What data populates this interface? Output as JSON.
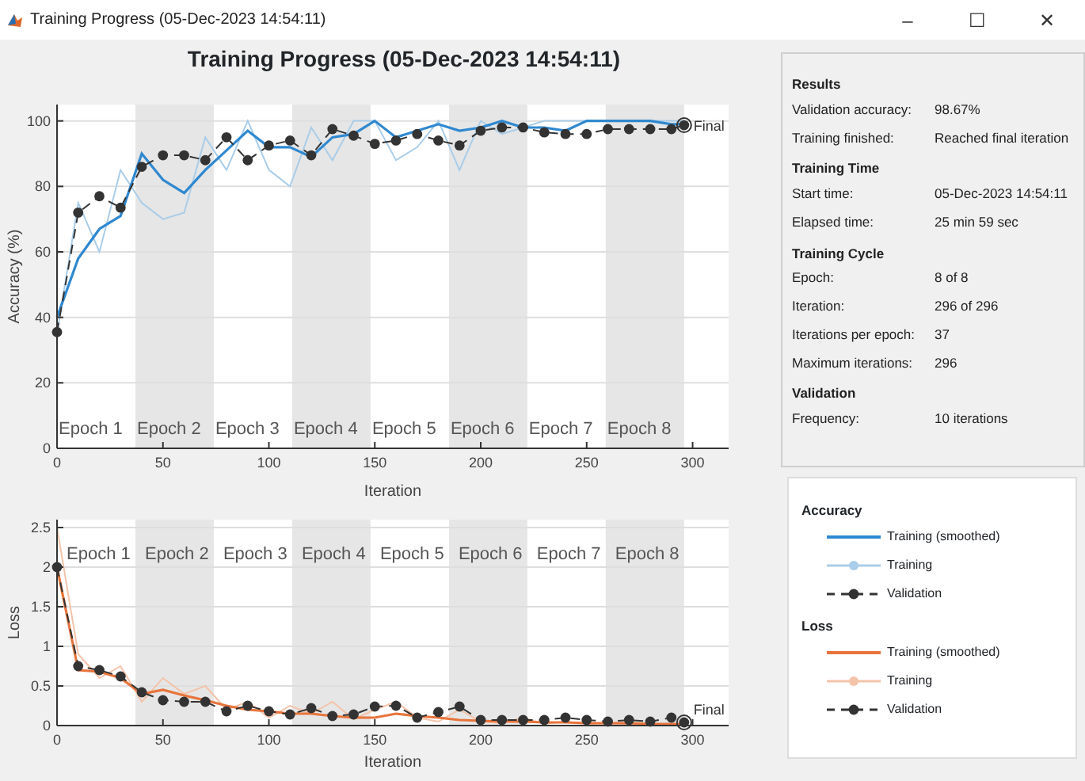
{
  "window": {
    "title": "Training Progress (05-Dec-2023 14:54:11)",
    "controls": [
      "–",
      "☐",
      "✕"
    ]
  },
  "heading": "Training Progress (05-Dec-2023 14:54:11)",
  "accuracy_plot": {
    "chart_data": {
      "type": "line",
      "xlabel": "Iteration",
      "ylabel": "Accuracy (%)",
      "grid": true,
      "x": [
        0,
        10,
        20,
        30,
        40,
        50,
        60,
        70,
        80,
        90,
        100,
        110,
        120,
        130,
        140,
        150,
        160,
        170,
        180,
        190,
        200,
        210,
        220,
        230,
        240,
        250,
        260,
        270,
        280,
        290,
        296
      ],
      "xlim": [
        0,
        317
      ],
      "ylim": [
        0,
        105
      ],
      "xticks": [
        0,
        50,
        100,
        150,
        200,
        250,
        300
      ],
      "yticks": [
        0,
        20,
        40,
        60,
        80,
        100
      ],
      "series": [
        {
          "name": "Training (smoothed)",
          "color": "#2f88d0",
          "line_style": "solid",
          "values": [
            40,
            58,
            67,
            71,
            90,
            82,
            78,
            85,
            91,
            97,
            92,
            92,
            89,
            95,
            96,
            100,
            95,
            97,
            99,
            97,
            98,
            100,
            98,
            98,
            97,
            100,
            100,
            100,
            100,
            99,
            99
          ]
        },
        {
          "name": "Training",
          "color": "#a9cde9",
          "line_style": "solid",
          "values": [
            35,
            75,
            60,
            85,
            75,
            70,
            72,
            95,
            85,
            100,
            85,
            80,
            98,
            88,
            100,
            100,
            88,
            92,
            100,
            85,
            100,
            96,
            98,
            100,
            100,
            100,
            100,
            100,
            100,
            100,
            100
          ]
        },
        {
          "name": "Validation",
          "color": "#333333",
          "line_style": "dashed",
          "marker": "circle",
          "values": [
            35.5,
            72,
            77,
            73.5,
            86,
            89.5,
            89.5,
            88,
            95,
            88,
            92.5,
            94,
            89.5,
            97.5,
            95.5,
            93,
            94,
            96,
            94,
            92.5,
            97,
            98,
            98,
            96.5,
            96,
            96,
            97.5,
            97.5,
            97.5,
            97.5,
            98.7
          ]
        }
      ],
      "annotations": [
        "Epoch 1",
        "Epoch 2",
        "Epoch 3",
        "Epoch 4",
        "Epoch 5",
        "Epoch 6",
        "Epoch 7",
        "Epoch 8",
        "Final"
      ]
    }
  },
  "loss_plot": {
    "chart_data": {
      "type": "line",
      "xlabel": "Iteration",
      "ylabel": "Loss",
      "grid": true,
      "x": [
        0,
        10,
        20,
        30,
        40,
        50,
        60,
        70,
        80,
        90,
        100,
        110,
        120,
        130,
        140,
        150,
        160,
        170,
        180,
        190,
        200,
        210,
        220,
        230,
        240,
        250,
        260,
        270,
        280,
        290,
        296
      ],
      "xlim": [
        0,
        317
      ],
      "ylim": [
        0,
        2.6
      ],
      "xticks": [
        0,
        50,
        100,
        150,
        200,
        250,
        300
      ],
      "yticks": [
        0,
        0.5,
        1,
        1.5,
        2,
        2.5
      ],
      "series": [
        {
          "name": "Training (smoothed)",
          "color": "#e8743b",
          "line_style": "solid",
          "values": [
            2.0,
            0.7,
            0.68,
            0.6,
            0.4,
            0.45,
            0.38,
            0.32,
            0.25,
            0.2,
            0.18,
            0.15,
            0.15,
            0.12,
            0.1,
            0.1,
            0.15,
            0.12,
            0.1,
            0.07,
            0.06,
            0.05,
            0.05,
            0.04,
            0.04,
            0.03,
            0.03,
            0.03,
            0.02,
            0.02,
            0.02
          ]
        },
        {
          "name": "Training",
          "color": "#f4c3a9",
          "line_style": "solid",
          "values": [
            2.5,
            0.9,
            0.6,
            0.75,
            0.3,
            0.6,
            0.4,
            0.5,
            0.2,
            0.3,
            0.1,
            0.25,
            0.15,
            0.3,
            0.08,
            0.2,
            0.3,
            0.1,
            0.05,
            0.2,
            0.05,
            0.03,
            0.1,
            0.02,
            0.05,
            0.02,
            0.03,
            0.02,
            0.02,
            0.01,
            0.01
          ]
        },
        {
          "name": "Validation",
          "color": "#333333",
          "line_style": "dashed",
          "marker": "circle",
          "values": [
            2.0,
            0.75,
            0.7,
            0.62,
            0.42,
            0.32,
            0.3,
            0.3,
            0.18,
            0.25,
            0.18,
            0.14,
            0.22,
            0.12,
            0.14,
            0.24,
            0.25,
            0.1,
            0.17,
            0.24,
            0.07,
            0.07,
            0.07,
            0.07,
            0.1,
            0.07,
            0.05,
            0.07,
            0.05,
            0.1,
            0.04
          ]
        }
      ],
      "annotations": [
        "Epoch 1",
        "Epoch 2",
        "Epoch 3",
        "Epoch 4",
        "Epoch 5",
        "Epoch 6",
        "Epoch 7",
        "Epoch 8",
        "Final"
      ]
    }
  },
  "info_sections": [
    {
      "heading": "Results",
      "rows": [
        {
          "label": "Validation accuracy:",
          "value": "98.67%"
        },
        {
          "label": "Training finished:",
          "value": "Reached final iteration"
        }
      ]
    },
    {
      "heading": "Training Time",
      "rows": [
        {
          "label": "Start time:",
          "value": "05-Dec-2023 14:54:11"
        },
        {
          "label": "Elapsed time:",
          "value": "25 min 59 sec"
        }
      ]
    },
    {
      "heading": "Training Cycle",
      "rows": [
        {
          "label": "Epoch:",
          "value": "8 of 8"
        },
        {
          "label": "Iteration:",
          "value": "296 of 296"
        },
        {
          "label": "Iterations per epoch:",
          "value": "37"
        },
        {
          "label": "Maximum iterations:",
          "value": "296"
        }
      ]
    },
    {
      "heading": "Validation",
      "rows": [
        {
          "label": "Frequency:",
          "value": "10 iterations"
        }
      ]
    }
  ],
  "legend_headings": [
    "Accuracy",
    "Loss"
  ]
}
